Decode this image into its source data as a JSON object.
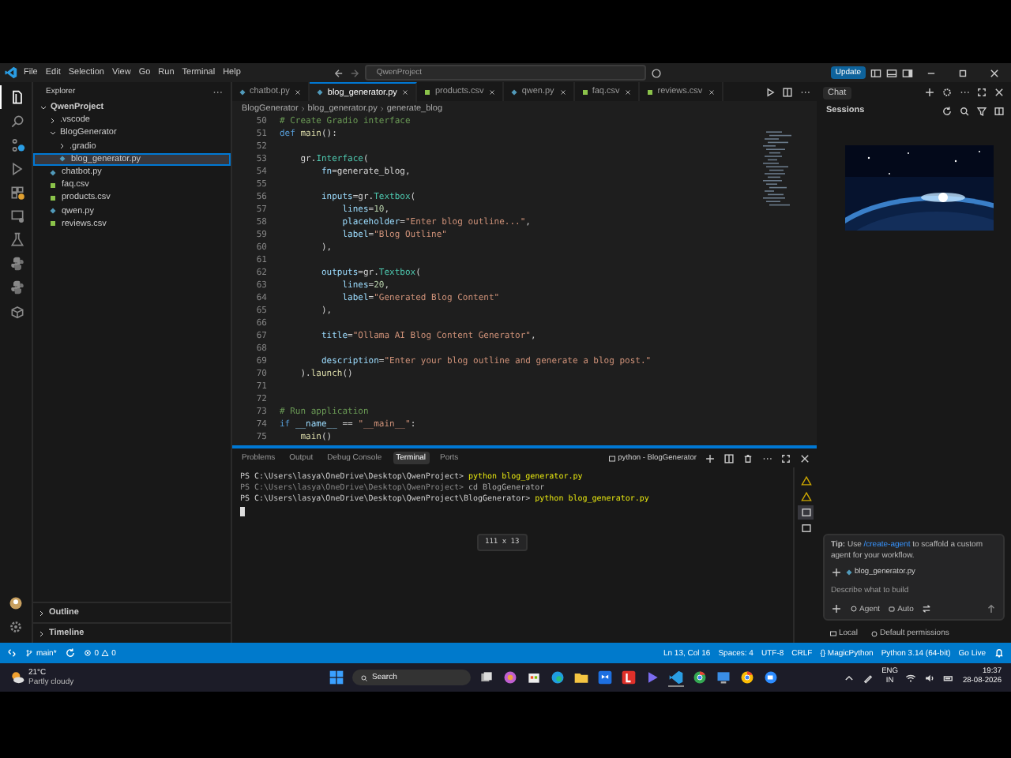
{
  "title_bar": {
    "menu": [
      "File",
      "Edit",
      "Selection",
      "View",
      "Go",
      "Run",
      "Terminal",
      "Help"
    ],
    "search": "QwenProject",
    "update_button": "Update"
  },
  "activity_bar": [
    {
      "kind": "files",
      "selected": true
    },
    {
      "kind": "search",
      "selected": false
    },
    {
      "kind": "source-control",
      "selected": false
    },
    {
      "kind": "run",
      "selected": false
    },
    {
      "kind": "extensions",
      "selected": false
    },
    {
      "kind": "remote",
      "selected": false
    },
    {
      "kind": "testing",
      "selected": false
    },
    {
      "kind": "python",
      "selected": false
    },
    {
      "kind": "python",
      "selected": false
    },
    {
      "kind": "container",
      "selected": false
    }
  ],
  "explorer": {
    "title": "Explorer",
    "tree": [
      {
        "label": "QwenProject",
        "kind": "root",
        "expanded": true,
        "selected": false,
        "children": [
          {
            "label": ".vscode",
            "kind": "folder",
            "expanded": false,
            "selected": false
          },
          {
            "label": "BlogGenerator",
            "kind": "folder",
            "expanded": true,
            "selected": false,
            "children": [
              {
                "label": ".gradio",
                "kind": "folder",
                "expanded": false,
                "selected": false
              },
              {
                "label": "blog_generator.py",
                "kind": "py",
                "selected": true
              }
            ]
          },
          {
            "label": "chatbot.py",
            "kind": "py",
            "selected": false
          },
          {
            "label": "faq.csv",
            "kind": "csv",
            "selected": false
          },
          {
            "label": "products.csv",
            "kind": "csv",
            "selected": false
          },
          {
            "label": "qwen.py",
            "kind": "py",
            "selected": false
          },
          {
            "label": "reviews.csv",
            "kind": "csv",
            "selected": false
          }
        ]
      }
    ],
    "sections": [
      {
        "label": "Outline",
        "expanded": false
      },
      {
        "label": "Timeline",
        "expanded": false
      }
    ]
  },
  "tabs": [
    {
      "label": "chatbot.py",
      "kind": "py",
      "selected": false
    },
    {
      "label": "blog_generator.py",
      "kind": "py",
      "selected": true
    },
    {
      "label": "products.csv",
      "kind": "csv",
      "selected": false
    },
    {
      "label": "qwen.py",
      "kind": "py",
      "selected": false
    },
    {
      "label": "faq.csv",
      "kind": "csv",
      "selected": false
    },
    {
      "label": "reviews.csv",
      "kind": "csv",
      "selected": false
    }
  ],
  "breadcrumb": [
    "BlogGenerator",
    "blog_generator.py",
    "generate_blog"
  ],
  "code": [
    {
      "n": "50",
      "tokens": [
        {
          "text": "# Create Gradio interface",
          "kind": "comment"
        }
      ]
    },
    {
      "n": "51",
      "tokens": [
        {
          "text": "def ",
          "kind": "keyword"
        },
        {
          "text": "main",
          "kind": "function"
        },
        {
          "text": "():",
          "kind": "plain"
        }
      ]
    },
    {
      "n": "52"
    },
    {
      "n": "53",
      "tokens": [
        {
          "text": "    gr.",
          "kind": "plain"
        },
        {
          "text": "Interface",
          "kind": "type"
        },
        {
          "text": "(",
          "kind": "plain"
        }
      ]
    },
    {
      "n": "54",
      "tokens": [
        {
          "text": "        fn",
          "kind": "variable"
        },
        {
          "text": "=generate_blog,",
          "kind": "plain"
        }
      ]
    },
    {
      "n": "55"
    },
    {
      "n": "56",
      "tokens": [
        {
          "text": "        inputs",
          "kind": "variable"
        },
        {
          "text": "=gr.",
          "kind": "plain"
        },
        {
          "text": "Textbox",
          "kind": "type"
        },
        {
          "text": "(",
          "kind": "plain"
        }
      ]
    },
    {
      "n": "57",
      "tokens": [
        {
          "text": "            lines",
          "kind": "variable"
        },
        {
          "text": "=",
          "kind": "plain"
        },
        {
          "text": "10",
          "kind": "number"
        },
        {
          "text": ",",
          "kind": "plain"
        }
      ]
    },
    {
      "n": "58",
      "tokens": [
        {
          "text": "            placeholder",
          "kind": "variable"
        },
        {
          "text": "=",
          "kind": "plain"
        },
        {
          "text": "\"Enter blog outline...\"",
          "kind": "string"
        },
        {
          "text": ",",
          "kind": "plain"
        }
      ]
    },
    {
      "n": "59",
      "tokens": [
        {
          "text": "            label",
          "kind": "variable"
        },
        {
          "text": "=",
          "kind": "plain"
        },
        {
          "text": "\"Blog Outline\"",
          "kind": "string"
        }
      ]
    },
    {
      "n": "60",
      "tokens": [
        {
          "text": "        ),",
          "kind": "plain"
        }
      ]
    },
    {
      "n": "61"
    },
    {
      "n": "62",
      "tokens": [
        {
          "text": "        outputs",
          "kind": "variable"
        },
        {
          "text": "=gr.",
          "kind": "plain"
        },
        {
          "text": "Textbox",
          "kind": "type"
        },
        {
          "text": "(",
          "kind": "plain"
        }
      ]
    },
    {
      "n": "63",
      "tokens": [
        {
          "text": "            lines",
          "kind": "variable"
        },
        {
          "text": "=",
          "kind": "plain"
        },
        {
          "text": "20",
          "kind": "number"
        },
        {
          "text": ",",
          "kind": "plain"
        }
      ]
    },
    {
      "n": "64",
      "tokens": [
        {
          "text": "            label",
          "kind": "variable"
        },
        {
          "text": "=",
          "kind": "plain"
        },
        {
          "text": "\"Generated Blog Content\"",
          "kind": "string"
        }
      ]
    },
    {
      "n": "65",
      "tokens": [
        {
          "text": "        ),",
          "kind": "plain"
        }
      ]
    },
    {
      "n": "66"
    },
    {
      "n": "67",
      "tokens": [
        {
          "text": "        title",
          "kind": "variable"
        },
        {
          "text": "=",
          "kind": "plain"
        },
        {
          "text": "\"Ollama AI Blog Content Generator\"",
          "kind": "string"
        },
        {
          "text": ",",
          "kind": "plain"
        }
      ]
    },
    {
      "n": "68"
    },
    {
      "n": "69",
      "tokens": [
        {
          "text": "        description",
          "kind": "variable"
        },
        {
          "text": "=",
          "kind": "plain"
        },
        {
          "text": "\"Enter your blog outline and generate a blog post.\"",
          "kind": "string"
        }
      ]
    },
    {
      "n": "70",
      "tokens": [
        {
          "text": "    ).",
          "kind": "plain"
        },
        {
          "text": "launch",
          "kind": "function"
        },
        {
          "text": "()",
          "kind": "plain"
        }
      ]
    },
    {
      "n": "71"
    },
    {
      "n": "72"
    },
    {
      "n": "73",
      "tokens": [
        {
          "text": "# Run application",
          "kind": "comment"
        }
      ]
    },
    {
      "n": "74",
      "tokens": [
        {
          "text": "if ",
          "kind": "keyword"
        },
        {
          "text": "__name__",
          "kind": "variable"
        },
        {
          "text": " == ",
          "kind": "plain"
        },
        {
          "text": "\"__main__\"",
          "kind": "string"
        },
        {
          "text": ":",
          "kind": "plain"
        }
      ]
    },
    {
      "n": "75",
      "tokens": [
        {
          "text": "    main",
          "kind": "function"
        },
        {
          "text": "()",
          "kind": "plain"
        }
      ]
    }
  ],
  "panel": {
    "tabs": [
      {
        "label": "Problems",
        "selected": false
      },
      {
        "label": "Output",
        "selected": false
      },
      {
        "label": "Debug Console",
        "selected": false
      },
      {
        "label": "Terminal",
        "selected": true
      },
      {
        "label": "Ports",
        "selected": false
      }
    ],
    "terminal_name": "python - BlogGenerator",
    "lines": [
      {
        "prompt": "PS C:\\Users\\lasya\\OneDrive\\Desktop\\QwenProject> ",
        "command": "python blog_generator.py",
        "kind": "plain"
      },
      {
        "prompt": "PS C:\\Users\\lasya\\OneDrive\\Desktop\\QwenProject> ",
        "command": "cd BlogGenerator",
        "kind": "done"
      },
      {
        "prompt": "PS C:\\Users\\lasya\\OneDrive\\Desktop\\QwenProject\\BlogGenerator> ",
        "command": "python blog_generator.py",
        "kind": "running"
      }
    ],
    "size_tooltip": "111 x 13",
    "sessions": [
      {
        "kind": "warning",
        "selected": false
      },
      {
        "kind": "warning",
        "selected": false
      },
      {
        "kind": "terminal",
        "selected": true
      },
      {
        "kind": "terminal",
        "selected": false
      }
    ]
  },
  "chat": {
    "tab": "Chat",
    "sessions": "Sessions",
    "tip_bold": "Tip:",
    "tip_before": "Use ",
    "tip_link": "/create-agent",
    "tip_after": " to scaffold a custom agent for your workflow.",
    "attachment": "blog_generator.py",
    "placeholder": "Describe what to build",
    "agent": "Agent",
    "auto": "Auto",
    "local": "Local",
    "permissions": "Default permissions"
  },
  "status_bar": {
    "branch": "main*",
    "errors": "0",
    "warnings": "0",
    "right": [
      "Ln 13, Col 16",
      "Spaces: 4",
      "UTF-8",
      "CRLF",
      "{} MagicPython",
      "Python 3.14 (64-bit)",
      "Go Live"
    ]
  },
  "taskbar": {
    "temperature": "21°C",
    "weather": "Partly cloudy",
    "search": "Search",
    "language": "ENG",
    "region": "IN",
    "time": "19:37",
    "date": "28-08-2026"
  }
}
